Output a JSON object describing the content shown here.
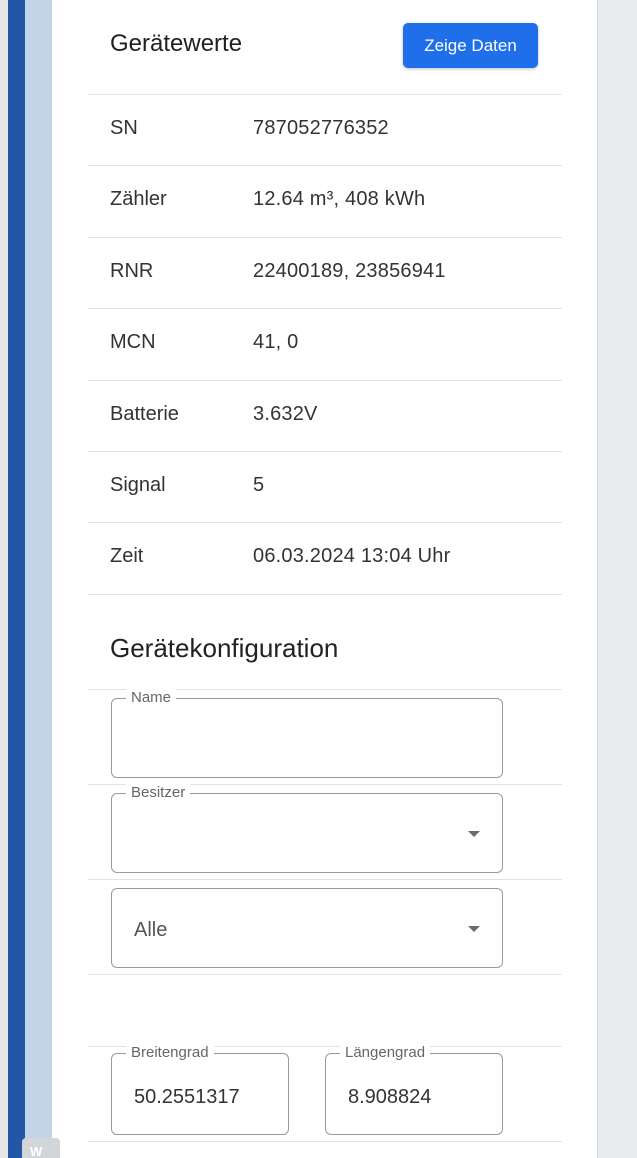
{
  "device_values": {
    "title": "Gerätewerte",
    "show_data_button": "Zeige Daten",
    "rows": [
      {
        "label": "SN",
        "value": "787052776352"
      },
      {
        "label": "Zähler",
        "value": "12.64 m³,  408 kWh"
      },
      {
        "label": "RNR",
        "value": "22400189,  23856941"
      },
      {
        "label": "MCN",
        "value": "41,  0"
      },
      {
        "label": "Batterie",
        "value": "3.632V"
      },
      {
        "label": "Signal",
        "value": "5"
      },
      {
        "label": "Zeit",
        "value": "06.03.2024 13:04 Uhr"
      }
    ]
  },
  "device_config": {
    "title": "Gerätekonfiguration",
    "name_field": {
      "label": "Name",
      "value": ""
    },
    "owner_select": {
      "label": "Besitzer",
      "value": ""
    },
    "filter_select": {
      "value": "Alle"
    },
    "latitude": {
      "label": "Breitengrad",
      "value": "50.2551317"
    },
    "longitude": {
      "label": "Längengrad",
      "value": "8.908824"
    }
  },
  "watermark_text": "W",
  "colors": {
    "button": "#1f6feb",
    "rail_dark": "#2456a6",
    "rail_light": "#c3d3e8"
  }
}
